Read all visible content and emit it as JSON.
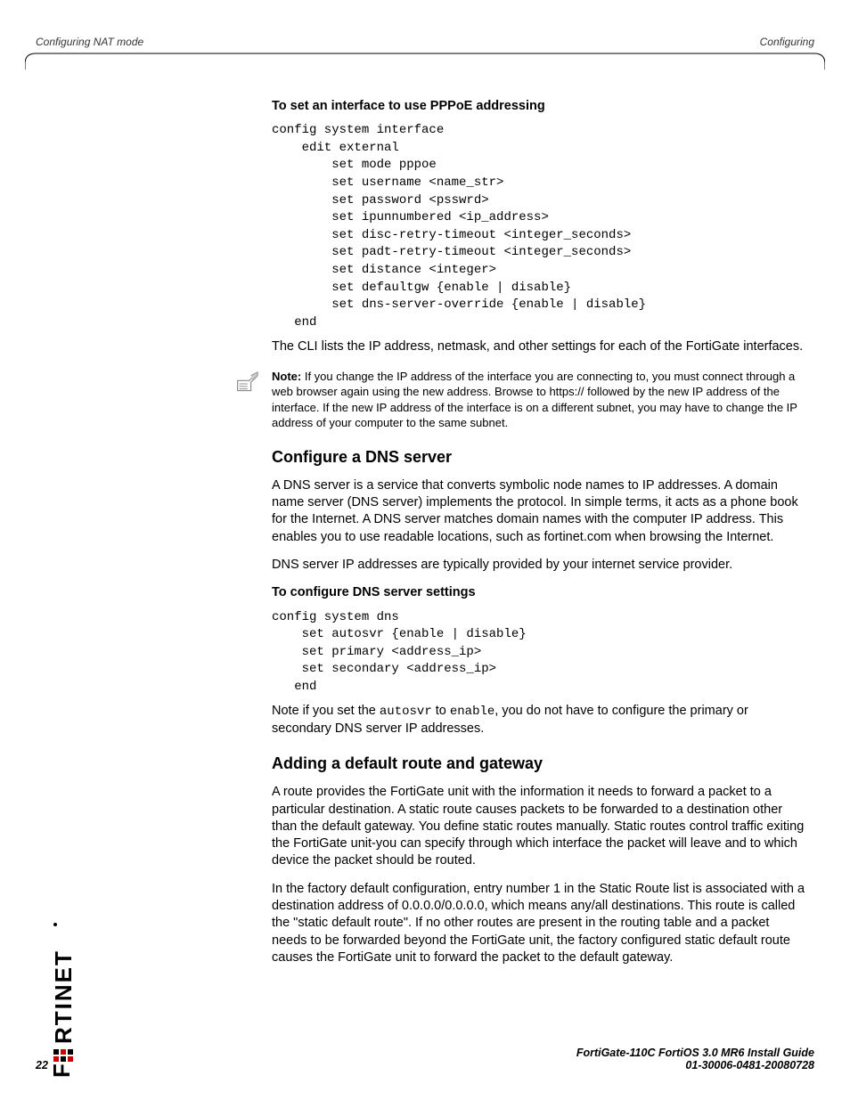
{
  "header": {
    "left": "Configuring NAT mode",
    "right": "Configuring"
  },
  "sec1": {
    "title": "To set an interface to use PPPoE addressing",
    "code": "config system interface\n    edit external\n        set mode pppoe\n        set username <name_str>\n        set password <psswrd>\n        set ipunnumbered <ip_address>\n        set disc-retry-timeout <integer_seconds>\n        set padt-retry-timeout <integer_seconds>\n        set distance <integer>\n        set defaultgw {enable | disable}\n        set dns-server-override {enable | disable}\n   end",
    "body": "The CLI lists the IP address, netmask, and other settings for each of the FortiGate interfaces."
  },
  "note": {
    "label": "Note:",
    "text": " If you change the IP address of the interface you are connecting to, you must connect through a web browser again using the new address. Browse to https:// followed by the new IP address of the interface. If the new IP address of the interface is on a different subnet, you may have to change the IP address of your computer to the same subnet."
  },
  "sec2": {
    "heading": "Configure a DNS server",
    "p1": "A DNS server is a service that converts symbolic node names to IP addresses. A domain name server (DNS server) implements the protocol. In simple terms, it acts as a phone book for the Internet. A DNS server matches domain names with the computer IP address. This enables you to use readable locations, such as fortinet.com when browsing the Internet.",
    "p2": "DNS server IP addresses are typically provided by your internet service provider.",
    "subtitle": "To configure DNS server settings",
    "code": "config system dns\n    set autosvr {enable | disable}\n    set primary <address_ip>\n    set secondary <address_ip>\n   end",
    "p3a": "Note if you set the ",
    "p3code1": "autosvr",
    "p3b": " to ",
    "p3code2": "enable",
    "p3c": ", you do not have to configure the primary or secondary DNS server IP addresses."
  },
  "sec3": {
    "heading": "Adding a default route and gateway",
    "p1": "A route provides the FortiGate unit with the information it needs to forward a packet to a particular destination. A static route causes packets to be forwarded to a destination other than the default gateway. You define static routes manually. Static routes control traffic exiting the FortiGate unit-you can specify through which interface the packet will leave and to which device the packet should be routed.",
    "p2": "In the factory default configuration, entry number 1 in the Static Route list is associated with a destination address of 0.0.0.0/0.0.0.0, which means any/all destinations. This route is called the \"static default route\". If no other routes are present in the routing table and a packet needs to be forwarded beyond the FortiGate unit, the factory configured static default route causes the FortiGate unit to forward the packet to the default gateway."
  },
  "footer": {
    "page": "22",
    "line1": "FortiGate-110C FortiOS 3.0 MR6 Install Guide",
    "line2": "01-30006-0481-20080728"
  }
}
